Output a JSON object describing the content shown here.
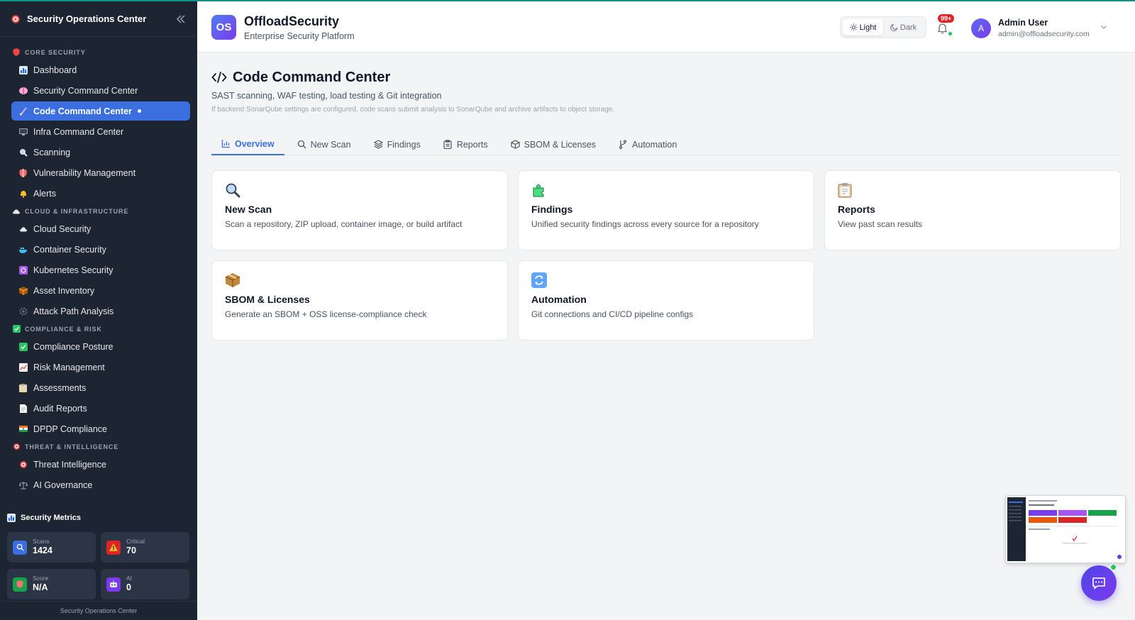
{
  "sidebar": {
    "title": "Security Operations Center",
    "footer": "Security Operations Center",
    "sections": [
      {
        "label": "CORE SECURITY",
        "icon": "shield-icon",
        "items": [
          {
            "label": "Dashboard",
            "icon": "bar-chart-icon"
          },
          {
            "label": "Security Command Center",
            "icon": "brain-icon"
          },
          {
            "label": "Code Command Center",
            "icon": "code-icon",
            "active": true
          },
          {
            "label": "Infra Command Center",
            "icon": "monitor-icon"
          },
          {
            "label": "Scanning",
            "icon": "magnifier-icon"
          },
          {
            "label": "Vulnerability Management",
            "icon": "shield-icon"
          },
          {
            "label": "Alerts",
            "icon": "bell-icon"
          }
        ]
      },
      {
        "label": "CLOUD & INFRASTRUCTURE",
        "icon": "cloud-icon",
        "items": [
          {
            "label": "Cloud Security",
            "icon": "cloud-icon"
          },
          {
            "label": "Container Security",
            "icon": "whale-icon"
          },
          {
            "label": "Kubernetes Security",
            "icon": "helm-icon"
          },
          {
            "label": "Asset Inventory",
            "icon": "package-icon"
          },
          {
            "label": "Attack Path Analysis",
            "icon": "gear-icon"
          }
        ]
      },
      {
        "label": "COMPLIANCE & RISK",
        "icon": "check-icon",
        "items": [
          {
            "label": "Compliance Posture",
            "icon": "check-icon"
          },
          {
            "label": "Risk Management",
            "icon": "trend-icon"
          },
          {
            "label": "Assessments",
            "icon": "clipboard-icon"
          },
          {
            "label": "Audit Reports",
            "icon": "document-icon"
          },
          {
            "label": "DPDP Compliance",
            "icon": "flag-icon"
          }
        ]
      },
      {
        "label": "THREAT & INTELLIGENCE",
        "icon": "target-icon",
        "items": [
          {
            "label": "Threat Intelligence",
            "icon": "target-icon"
          },
          {
            "label": "AI Governance",
            "icon": "scale-icon"
          }
        ]
      }
    ],
    "metrics_title": "Security Metrics",
    "metrics": [
      {
        "label": "Scans",
        "value": "1424",
        "icon": "search-icon",
        "color": "#3b6fe0"
      },
      {
        "label": "Critical",
        "value": "70",
        "icon": "warning-icon",
        "color": "#dc2626"
      },
      {
        "label": "Score",
        "value": "N/A",
        "icon": "shield-icon",
        "color": "#16a34a"
      },
      {
        "label": "AI",
        "value": "0",
        "icon": "robot-icon",
        "color": "#7c3aed"
      }
    ]
  },
  "header": {
    "brand_initials": "OS",
    "brand_name": "OffloadSecurity",
    "brand_sub": "Enterprise Security Platform",
    "theme_light": "Light",
    "theme_dark": "Dark",
    "notif_count": "99+",
    "user_initial": "A",
    "user_name": "Admin User",
    "user_email": "admin@offloadsecurity.com"
  },
  "main": {
    "title": "Code Command Center",
    "subtitle": "SAST scanning, WAF testing, load testing & Git integration",
    "note": "If backend SonarQube settings are configured, code scans submit analysis to SonarQube and archive artifacts to object storage.",
    "tabs": [
      {
        "label": "Overview",
        "icon": "bar-chart-icon",
        "active": true
      },
      {
        "label": "New Scan",
        "icon": "search-icon"
      },
      {
        "label": "Findings",
        "icon": "layers-icon"
      },
      {
        "label": "Reports",
        "icon": "clipboard-icon"
      },
      {
        "label": "SBOM & Licenses",
        "icon": "box-icon"
      },
      {
        "label": "Automation",
        "icon": "git-branch-icon"
      }
    ],
    "cards": [
      {
        "title": "New Scan",
        "desc": "Scan a repository, ZIP upload, container image, or build artifact",
        "icon": "magnifier-icon"
      },
      {
        "title": "Findings",
        "desc": "Unified security findings across every source for a repository",
        "icon": "puzzle-icon"
      },
      {
        "title": "Reports",
        "desc": "View past scan results",
        "icon": "clipboard-icon"
      },
      {
        "title": "SBOM & Licenses",
        "desc": "Generate an SBOM + OSS license-compliance check",
        "icon": "package-icon"
      },
      {
        "title": "Automation",
        "desc": "Git connections and CI/CD pipeline configs",
        "icon": "refresh-icon"
      }
    ]
  },
  "colors": {
    "accent": "#3b6fe0",
    "sidebar_bg": "#1e2532",
    "critical": "#dc2626",
    "success": "#22c55e"
  }
}
